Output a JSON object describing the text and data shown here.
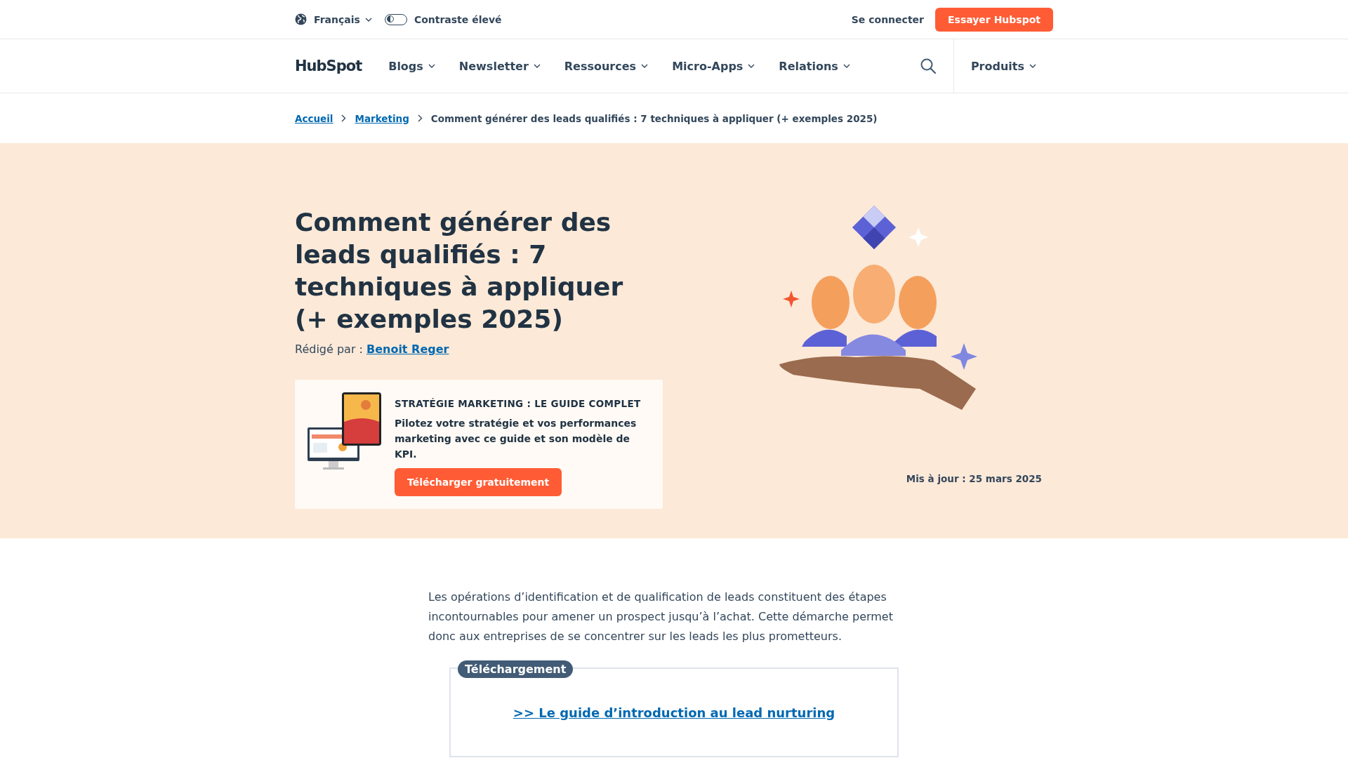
{
  "utility_bar": {
    "language": "Français",
    "contrast_toggle": {
      "label": "Contraste élevé",
      "on": false
    },
    "login": "Se connecter",
    "cta": "Essayer Hubspot"
  },
  "nav": {
    "logo": "HubSpot",
    "items": [
      {
        "label": "Blogs"
      },
      {
        "label": "Newsletter"
      },
      {
        "label": "Ressources"
      },
      {
        "label": "Micro-Apps"
      },
      {
        "label": "Relations"
      }
    ],
    "products": "Produits"
  },
  "breadcrumb": [
    {
      "label": "Accueil",
      "kind": "link"
    },
    {
      "label": "Marketing",
      "kind": "link"
    },
    {
      "label": "Comment générer des leads qualifiés : 7 techniques à appliquer (+ exemples 2025)",
      "kind": "current"
    }
  ],
  "hero": {
    "title": "Comment générer des leads qualifiés : 7 techniques à appliquer (+ exemples 2025)",
    "author_label": "Rédigé par :",
    "author": "Benoit Reger",
    "offer": {
      "heading": "STRATÉGIE MARKETING : LE GUIDE COMPLET",
      "text": "Pilotez votre stratégie et vos performances marketing avec ce guide et son modèle de KPI.",
      "button": "Télécharger gratuitement"
    },
    "updated": "Mis à jour : 25 mars 2025"
  },
  "article": {
    "intro": "Les opérations d’identification et de qualification de leads constituent des étapes incontournables pour amener un prospect jusqu’à l’achat. Cette démarche permet donc aux entreprises de se concentrer sur les leads les plus prometteurs.",
    "download": {
      "badge": "Téléchargement",
      "link": ">> Le guide d’introduction au lead nurturing"
    }
  }
}
